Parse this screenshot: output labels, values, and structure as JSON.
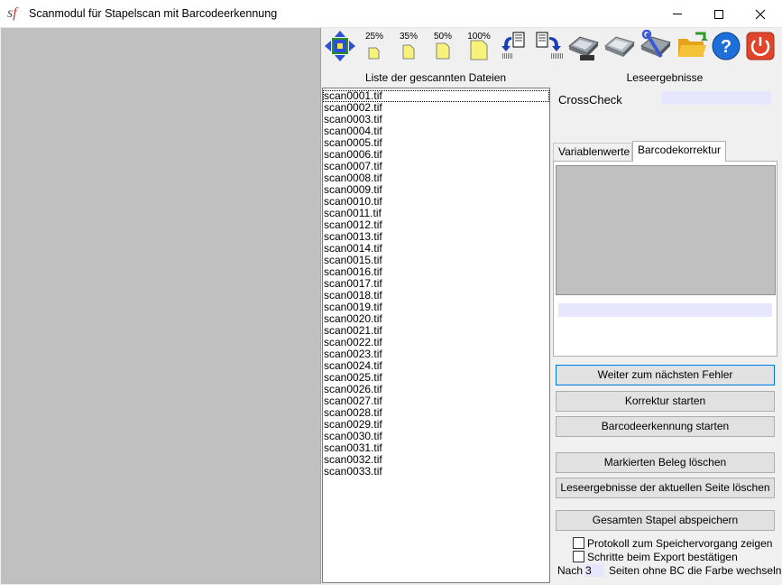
{
  "window": {
    "title": "Scanmodul für Stapelscan mit Barcodeerkennung",
    "logo_text_1": "s",
    "logo_text_2": "f"
  },
  "toolbar": {
    "zoom_25": "25%",
    "zoom_35": "35%",
    "zoom_50": "50%",
    "zoom_100": "100%",
    "icons": [
      "fit-arrows-icon",
      "zoom-25-icon",
      "zoom-35-icon",
      "zoom-50-icon",
      "zoom-100-icon",
      "rotate-left-icon",
      "rotate-right-icon",
      "scanner-icon",
      "scanner-light-icon",
      "scanner-settings-icon",
      "folder-open-icon",
      "help-icon",
      "power-icon"
    ]
  },
  "file_list": {
    "header": "Liste der gescannten Dateien",
    "items": [
      "scan0001.tif",
      "scan0002.tif",
      "scan0003.tif",
      "scan0004.tif",
      "scan0005.tif",
      "scan0006.tif",
      "scan0007.tif",
      "scan0008.tif",
      "scan0009.tif",
      "scan0010.tif",
      "scan0011.tif",
      "scan0012.tif",
      "scan0013.tif",
      "scan0014.tif",
      "scan0015.tif",
      "scan0016.tif",
      "scan0017.tif",
      "scan0018.tif",
      "scan0019.tif",
      "scan0020.tif",
      "scan0021.tif",
      "scan0022.tif",
      "scan0023.tif",
      "scan0024.tif",
      "scan0025.tif",
      "scan0026.tif",
      "scan0027.tif",
      "scan0028.tif",
      "scan0029.tif",
      "scan0030.tif",
      "scan0031.tif",
      "scan0032.tif",
      "scan0033.tif"
    ]
  },
  "results": {
    "header": "Leseergebnisse",
    "crosscheck_label": "CrossCheck",
    "crosscheck_value": "",
    "tabs": [
      "Variablenwerte",
      "Barcodekorrektur"
    ],
    "active_tab": "Barcodekorrektur",
    "barcode_value": ""
  },
  "buttons": {
    "next_error": "Weiter zum nächsten Fehler",
    "start_correction": "Korrektur starten",
    "start_barcode": "Barcodeerkennung starten",
    "delete_marked": "Markierten Beleg löschen",
    "delete_results": "Leseergebnisse der aktuellen Seite löschen",
    "save_stack": "Gesamten Stapel abspeichern"
  },
  "options": {
    "protocol_label": "Protokoll zum Speichervorgang zeigen",
    "protocol_checked": false,
    "confirm_label": "Schritte beim Export bestätigen",
    "confirm_checked": false,
    "nach_label": "Nach",
    "nach_value": "3",
    "nach_after": "Seiten ohne BC die Farbe wechseln"
  },
  "colors": {
    "accent": "#0078d7",
    "field_bg": "#e6e6ff",
    "preview_bg": "#c0c0c0",
    "help_blue": "#1e6fd9",
    "power_red": "#e0452b",
    "page_yellow": "#f7f27a"
  }
}
